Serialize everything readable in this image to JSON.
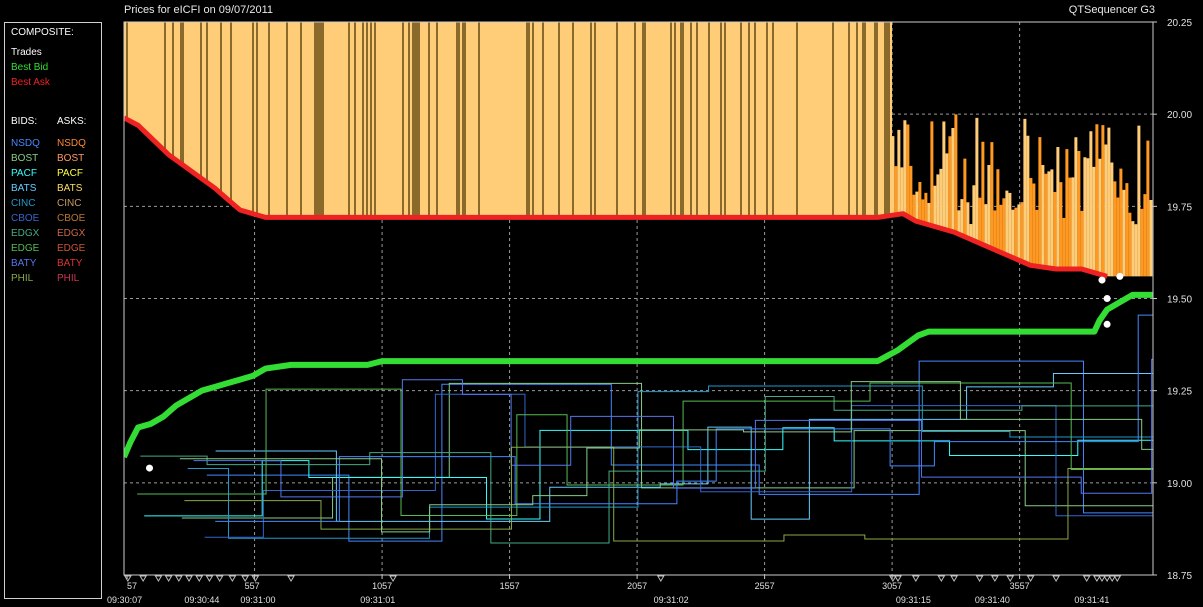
{
  "header": {
    "title": "Prices for  eICFI  on  09/07/2011",
    "app_name": "QTSequencer G3"
  },
  "legend": {
    "composite_heading": "COMPOSITE:",
    "composite": [
      {
        "label": "Trades",
        "color": "#ffffff"
      },
      {
        "label": "Best Bid",
        "color": "#33dd33"
      },
      {
        "label": "Best Ask",
        "color": "#ee2222"
      }
    ],
    "bids_heading": "BIDS:",
    "asks_heading": "ASKS:",
    "venues": [
      {
        "bid": "NSDQ",
        "ask": "NSDQ",
        "bid_color": "#4488ff",
        "ask_color": "#ff8833"
      },
      {
        "bid": "BOST",
        "ask": "BOST",
        "bid_color": "#88cc88",
        "ask_color": "#ff9966"
      },
      {
        "bid": "PACF",
        "ask": "PACF",
        "bid_color": "#33ffff",
        "ask_color": "#ffff44"
      },
      {
        "bid": "BATS",
        "ask": "BATS",
        "bid_color": "#66ccff",
        "ask_color": "#ffdd66"
      },
      {
        "bid": "CINC",
        "ask": "CINC",
        "bid_color": "#2299cc",
        "ask_color": "#cc9966"
      },
      {
        "bid": "CBOE",
        "ask": "CBOE",
        "bid_color": "#3366cc",
        "ask_color": "#bb7733"
      },
      {
        "bid": "EDGX",
        "ask": "EDGX",
        "bid_color": "#44aa88",
        "ask_color": "#cc6644"
      },
      {
        "bid": "EDGE",
        "ask": "EDGE",
        "bid_color": "#55bb55",
        "ask_color": "#cc5533"
      },
      {
        "bid": "BATY",
        "ask": "BATY",
        "bid_color": "#5577ee",
        "ask_color": "#dd3333"
      },
      {
        "bid": "PHIL",
        "ask": "PHIL",
        "bid_color": "#88aa44",
        "ask_color": "#cc3355"
      }
    ]
  },
  "chart_data": {
    "type": "line",
    "x_ticks": [
      57,
      557,
      1057,
      1557,
      2057,
      2557,
      3057,
      3557
    ],
    "time_labels": [
      {
        "x": 57,
        "label": "09:30:07"
      },
      {
        "x": 360,
        "label": "09:30:44"
      },
      {
        "x": 580,
        "label": "09:31:00"
      },
      {
        "x": 1050,
        "label": "09:31:01"
      },
      {
        "x": 2200,
        "label": "09:31:02"
      },
      {
        "x": 3150,
        "label": "09:31:15"
      },
      {
        "x": 3460,
        "label": "09:31:40"
      },
      {
        "x": 3850,
        "label": "09:31:41"
      }
    ],
    "y_ticks": [
      18.75,
      19.0,
      19.25,
      19.5,
      19.75,
      20.0,
      20.25
    ],
    "xlim": [
      45,
      4080
    ],
    "ylim": [
      18.75,
      20.25
    ],
    "grid": true,
    "series": [
      {
        "name": "Best Ask",
        "color": "#ee2222",
        "x": [
          45,
          100,
          160,
          220,
          280,
          340,
          400,
          450,
          500,
          550,
          600,
          700,
          900,
          1500,
          2500,
          3000,
          3100,
          3150,
          3200,
          3300,
          3400,
          3500,
          3600,
          3700,
          3800,
          3850,
          3900
        ],
        "y": [
          19.99,
          19.97,
          19.93,
          19.89,
          19.86,
          19.83,
          19.8,
          19.77,
          19.74,
          19.73,
          19.72,
          19.72,
          19.72,
          19.72,
          19.72,
          19.72,
          19.73,
          19.71,
          19.7,
          19.68,
          19.65,
          19.62,
          19.59,
          19.58,
          19.58,
          19.57,
          19.56
        ]
      },
      {
        "name": "Best Bid",
        "color": "#33dd33",
        "x": [
          45,
          70,
          100,
          150,
          200,
          250,
          300,
          350,
          400,
          450,
          500,
          550,
          600,
          700,
          800,
          900,
          1000,
          1057,
          1500,
          2000,
          2500,
          3000,
          3080,
          3120,
          3160,
          3200,
          3600,
          3850,
          3870,
          3900,
          3950,
          4000,
          4080
        ],
        "y": [
          19.07,
          19.11,
          19.15,
          19.16,
          19.18,
          19.21,
          19.23,
          19.25,
          19.26,
          19.27,
          19.28,
          19.29,
          19.31,
          19.32,
          19.32,
          19.32,
          19.32,
          19.33,
          19.33,
          19.33,
          19.33,
          19.33,
          19.36,
          19.38,
          19.4,
          19.41,
          19.41,
          19.41,
          19.44,
          19.47,
          19.49,
          19.51,
          19.51
        ]
      },
      {
        "name": "Trades",
        "color": "#ffffff",
        "x": [
          145,
          3880,
          3900,
          3900,
          3950
        ],
        "y": [
          19.04,
          19.55,
          19.5,
          19.43,
          19.56
        ]
      }
    ]
  }
}
